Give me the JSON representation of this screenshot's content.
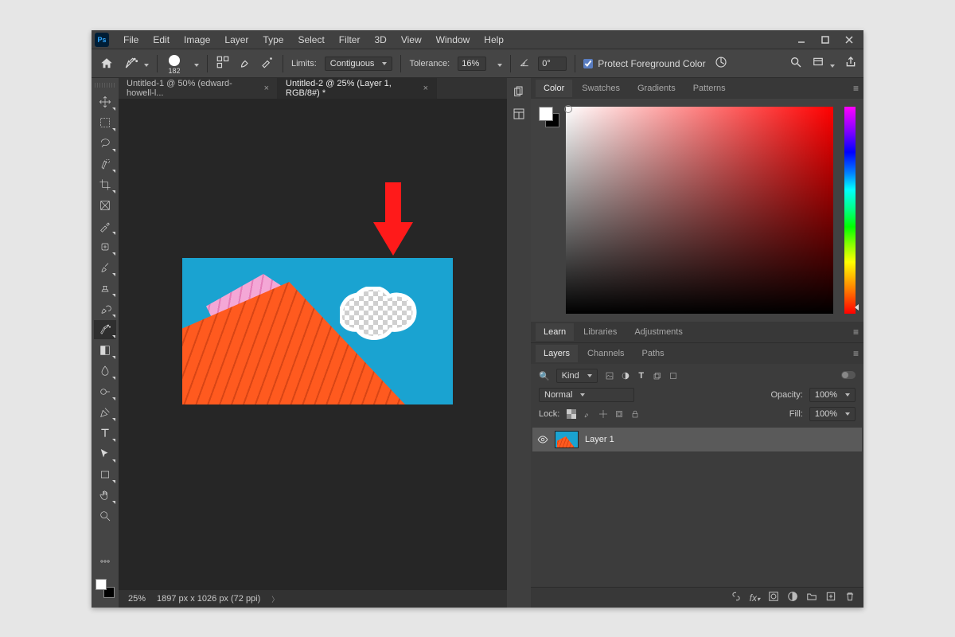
{
  "menubar": {
    "items": [
      "File",
      "Edit",
      "Image",
      "Layer",
      "Type",
      "Select",
      "Filter",
      "3D",
      "View",
      "Window",
      "Help"
    ]
  },
  "options": {
    "brush_size": "182",
    "limits_label": "Limits:",
    "limits_value": "Contiguous",
    "tolerance_label": "Tolerance:",
    "tolerance_value": "16%",
    "angle_value": "0°",
    "protect_fg_label": "Protect Foreground Color"
  },
  "doc_tabs": [
    {
      "label": "Untitled-1 @ 50% (edward-howell-l...",
      "active": false
    },
    {
      "label": "Untitled-2 @ 25% (Layer 1, RGB/8#) *",
      "active": true
    }
  ],
  "statusbar": {
    "zoom": "25%",
    "dims": "1897 px x 1026 px (72 ppi)"
  },
  "color_panel": {
    "tabs": [
      "Color",
      "Swatches",
      "Gradients",
      "Patterns"
    ],
    "active": 0
  },
  "mid_panel": {
    "tabs": [
      "Learn",
      "Libraries",
      "Adjustments"
    ],
    "active": 0
  },
  "layers_panel": {
    "tabs": [
      "Layers",
      "Channels",
      "Paths"
    ],
    "active": 0,
    "kind_label": "Kind",
    "blend_mode": "Normal",
    "opacity_label": "Opacity:",
    "opacity_value": "100%",
    "lock_label": "Lock:",
    "fill_label": "Fill:",
    "fill_value": "100%",
    "layers": [
      {
        "name": "Layer 1"
      }
    ]
  },
  "tool_strip": [
    "move-tool",
    "marquee-tool",
    "lasso-tool",
    "quick-select-tool",
    "crop-tool",
    "frame-tool",
    "eyedropper-tool",
    "healing-brush-tool",
    "brush-tool",
    "clone-stamp-tool",
    "history-brush-tool",
    "eraser-tool",
    "gradient-tool",
    "blur-tool",
    "dodge-tool",
    "pen-tool",
    "type-tool",
    "path-select-tool",
    "rectangle-tool",
    "hand-tool",
    "zoom-tool"
  ],
  "active_tool": 11
}
